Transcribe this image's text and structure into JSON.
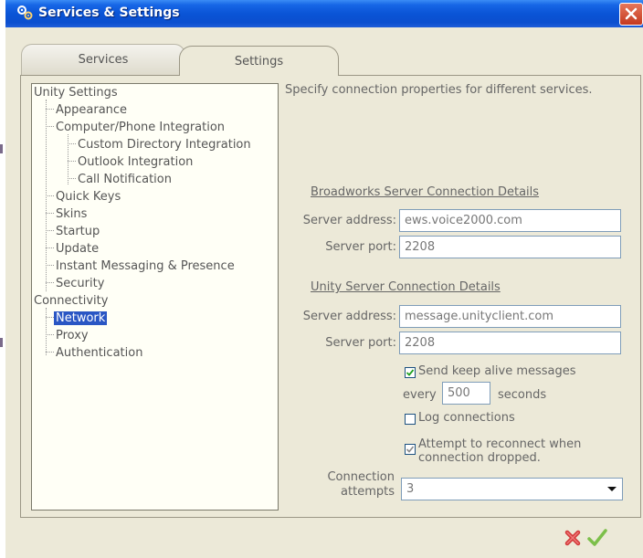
{
  "window": {
    "title": "Services & Settings"
  },
  "tabs": [
    {
      "label": "Services"
    },
    {
      "label": "Settings"
    }
  ],
  "tree": {
    "items": [
      {
        "label": "Unity Settings"
      },
      {
        "label": "Appearance"
      },
      {
        "label": "Computer/Phone Integration"
      },
      {
        "label": "Custom Directory Integration"
      },
      {
        "label": "Outlook Integration"
      },
      {
        "label": "Call Notification"
      },
      {
        "label": "Quick Keys"
      },
      {
        "label": "Skins"
      },
      {
        "label": "Startup"
      },
      {
        "label": "Update"
      },
      {
        "label": "Instant Messaging & Presence"
      },
      {
        "label": "Security"
      },
      {
        "label": "Connectivity"
      },
      {
        "label": "Network",
        "selected": true
      },
      {
        "label": "Proxy"
      },
      {
        "label": "Authentication"
      }
    ]
  },
  "content": {
    "description": "Specify connection properties for different services.",
    "broadworks": {
      "heading": "Broadworks Server Connection Details",
      "address_label": "Server address:",
      "address_value": "ews.voice2000.com",
      "port_label": "Server port:",
      "port_value": "2208"
    },
    "unity": {
      "heading": "Unity Server Connection Details",
      "address_label": "Server address:",
      "address_value": "message.unityclient.com",
      "port_label": "Server port:",
      "port_value": "2208"
    },
    "keepalive": {
      "label": "Send keep alive messages",
      "checked": true,
      "every_label": "every",
      "interval_value": "500",
      "seconds_label": "seconds"
    },
    "log_connections": {
      "label": "Log connections",
      "checked": false
    },
    "reconnect": {
      "label_line1": "Attempt to reconnect when",
      "label_line2": "connection dropped.",
      "checked": true
    },
    "attempts": {
      "label_line1": "Connection",
      "label_line2": "attempts",
      "value": "3"
    }
  },
  "footer": {
    "cancel_icon": "cancel-icon",
    "ok_icon": "ok-checkmark-icon"
  },
  "colors": {
    "titlebar": "#0a54d6",
    "selection": "#2a56c4",
    "window_bg": "#ece9d8"
  }
}
